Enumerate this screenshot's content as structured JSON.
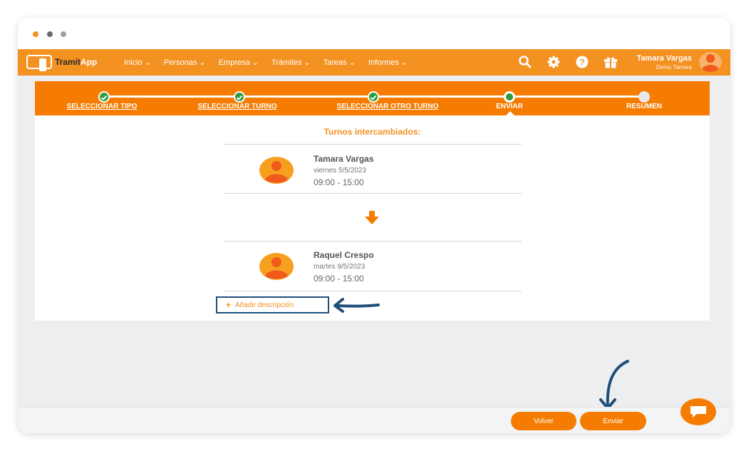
{
  "window": {
    "dot_colors": [
      "#f39121",
      "#6b6b6b",
      "#a0a0a0"
    ]
  },
  "navbar": {
    "brand_part1": "Tramit",
    "brand_part2": "App",
    "items": [
      {
        "label": "Inicio ⌄"
      },
      {
        "label": "Personas ⌄"
      },
      {
        "label": "Empresa ⌄"
      },
      {
        "label": "Trámites ⌄"
      },
      {
        "label": "Tareas ⌄"
      },
      {
        "label": "Informes ⌄"
      }
    ],
    "icons": [
      "search-icon",
      "gear-icon",
      "help-icon",
      "gift-icon"
    ],
    "user": {
      "name": "Tamara Vargas",
      "company": "Demo Tamara"
    }
  },
  "stepper": {
    "steps": [
      {
        "label": "SELECCIONAR TIPO",
        "state": "done"
      },
      {
        "label": "SELECCIONAR TURNO",
        "state": "done"
      },
      {
        "label": "SELECCIONAR OTRO TURNO",
        "state": "done"
      },
      {
        "label": "ENVIAR",
        "state": "current"
      },
      {
        "label": "RESUMEN",
        "state": "pending"
      }
    ]
  },
  "main": {
    "title": "Turnos intercambiados:",
    "shifts": [
      {
        "name": "Tamara Vargas",
        "date": "viernes 5/5/2023",
        "time": "09:00 - 15:00"
      },
      {
        "name": "Raquel Crespo",
        "date": "martes 9/5/2023",
        "time": "09:00 - 15:00"
      }
    ],
    "add_description": "Añadir descripción",
    "add_icon": "+"
  },
  "footer": {
    "back_label": "Volver",
    "send_label": "Enviar"
  },
  "colors": {
    "accent": "#f39121",
    "stepper": "#f57c00",
    "annotation": "#1f4e79",
    "check": "#2e9a3d"
  }
}
